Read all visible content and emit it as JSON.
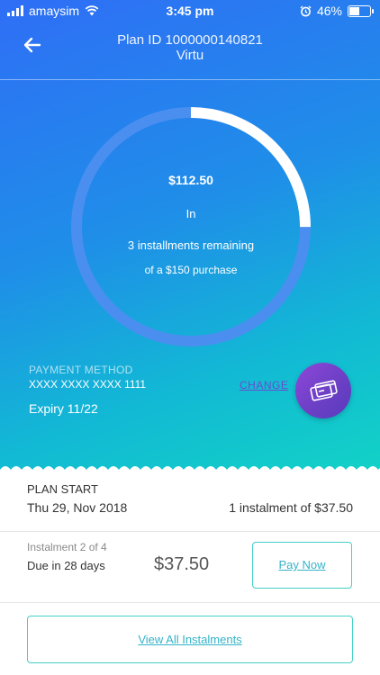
{
  "status_bar": {
    "carrier": "amaysim",
    "time": "3:45 pm",
    "battery": "46%",
    "battery_level": 0.46
  },
  "header": {
    "plan_id": "Plan ID 1000000140821",
    "merchant": "Virtu"
  },
  "progress": {
    "paid_fraction": 0.25,
    "amount": "$112.50",
    "in_text": "In",
    "remaining_text": "3 installments remaining",
    "purchase_text": "of a $150 purchase",
    "colors": {
      "track": "#4a8fef",
      "filled": "#ffffff"
    }
  },
  "payment_method": {
    "label": "PAYMENT METHOD",
    "card_number": "XXXX XXXX XXXX 1111",
    "expiry": "Expiry 11/22",
    "change_label": "CHANGE"
  },
  "plan_start": {
    "label": "PLAN START",
    "date": "Thu 29, Nov 2018",
    "instalment_text": "1 instalment of $37.50"
  },
  "next_instalment": {
    "label": "Instalment 2 of 4",
    "due_text": "Due in 28 days",
    "amount": "$37.50",
    "pay_now_label": "Pay Now"
  },
  "view_all_label": "View All Instalments",
  "colors": {
    "accent_teal": "#44d0c6",
    "link_blue": "#34b3c9",
    "card_button_purple": "#7a42cf"
  },
  "icons": [
    "signal-bars-icon",
    "wifi-icon",
    "alarm-icon",
    "battery-icon",
    "back-arrow-icon",
    "credit-cards-icon"
  ]
}
